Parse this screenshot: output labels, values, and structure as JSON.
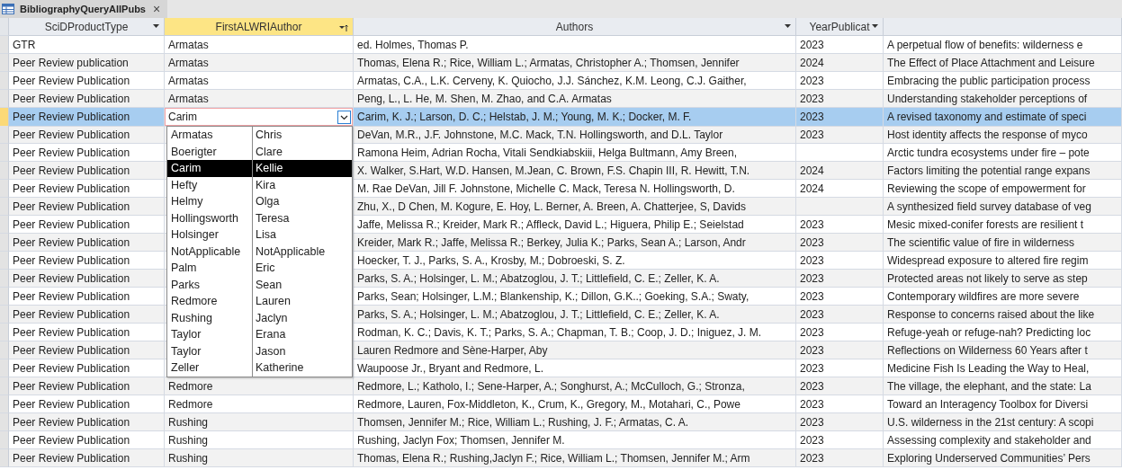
{
  "tab": {
    "title": "BibliographyQueryAllPubs",
    "close": "×"
  },
  "columns": [
    {
      "label": "SciDProductType",
      "kind": "filter",
      "active": false
    },
    {
      "label": "FirstALWRIAuthor",
      "kind": "sort",
      "active": true
    },
    {
      "label": "Authors",
      "kind": "filter",
      "active": false
    },
    {
      "label": "YearPublicat",
      "kind": "filter",
      "active": false
    },
    {
      "kind": "plain",
      "active": false
    }
  ],
  "rows": [
    {
      "type": "GTR",
      "first_author": "Armatas",
      "authors": "ed. Holmes, Thomas P.",
      "year": "2023",
      "title": "A perpetual flow of benefits: wilderness e",
      "selected": false,
      "editing": false
    },
    {
      "type": "Peer Review publication",
      "first_author": "Armatas",
      "authors": "Thomas, Elena R.; Rice, William L.; Armatas, Christopher A.; Thomsen, Jennifer",
      "year": "2024",
      "title": "The Effect of Place Attachment and Leisure",
      "selected": false,
      "editing": false
    },
    {
      "type": "Peer Review Publication",
      "first_author": "Armatas",
      "authors": "Armatas, C.A., L.K. Cerveny, K. Quiocho, J.J. Sánchez, K.M. Leong, C.J. Gaither,",
      "year": "2023",
      "title": "Embracing the public participation process",
      "selected": false,
      "editing": false
    },
    {
      "type": "Peer Review Publication",
      "first_author": "Armatas",
      "authors": "Peng, L., L. He, M. Shen, M. Zhao, and C.A. Armatas",
      "year": "2023",
      "title": "Understanding stakeholder perceptions of",
      "selected": false,
      "editing": false
    },
    {
      "type": "Peer Review Publication",
      "first_author": "Carim",
      "authors": "Carim, K. J.; Larson, D. C.; Helstab, J. M.; Young, M. K.; Docker, M. F.",
      "year": "2023",
      "title": "A revised taxonomy and estimate of speci",
      "selected": true,
      "editing": true
    },
    {
      "type": "Peer Review Publication",
      "authors": "DeVan, M.R., J.F. Johnstone, M.C. Mack, T.N. Hollingsworth, and D.L. Taylor",
      "year": "2023",
      "title": "Host identity affects the response of myco",
      "selected": false,
      "editing": false
    },
    {
      "type": "Peer Review Publication",
      "authors": "Ramona Heim, Adrian Rocha, Vitali Sendkiabskiii, Helga Bultmann, Amy Breen,",
      "title": "Arctic tundra ecosystems under fire – pote",
      "selected": false,
      "editing": false
    },
    {
      "type": "Peer Review Publication",
      "authors": "X. Walker, S.Hart, W.D. Hansen, M.Jean, C. Brown, F.S. Chapin III, R. Hewitt, T.N.",
      "year": "2024",
      "title": "Factors limiting the potential range expans",
      "selected": false,
      "editing": false
    },
    {
      "type": "Peer Review Publication",
      "authors": "M. Rae DeVan, Jill F. Johnstone, Michelle C. Mack, Teresa N. Hollingsworth, D.",
      "year": "2024",
      "title": "Reviewing the scope of empowerment for",
      "selected": false,
      "editing": false
    },
    {
      "type": "Peer Review Publication",
      "authors": "Zhu, X., D Chen, M. Kogure, E. Hoy, L. Berner, A. Breen, A. Chatterjee, S, Davids",
      "title": "A synthesized field survey database of veg",
      "selected": false,
      "editing": false
    },
    {
      "type": "Peer Review Publication",
      "authors": "Jaffe, Melissa R.; Kreider, Mark R.; Affleck, David L.; Higuera, Philip E.; Seielstad",
      "year": "2023",
      "title": "Mesic mixed-conifer forests are resilient t",
      "selected": false,
      "editing": false
    },
    {
      "type": "Peer Review Publication",
      "authors": "Kreider, Mark R.; Jaffe, Melissa R.; Berkey, Julia K.; Parks, Sean A.; Larson, Andr",
      "year": "2023",
      "title": "The scientific value of fire in wilderness",
      "selected": false,
      "editing": false
    },
    {
      "type": "Peer Review Publication",
      "authors": "Hoecker, T. J., Parks, S. A., Krosby, M.; Dobroeski, S. Z.",
      "year": "2023",
      "title": "Widespread exposure to altered fire regim",
      "selected": false,
      "editing": false
    },
    {
      "type": "Peer Review Publication",
      "authors": "Parks, S. A.; Holsinger, L. M.; Abatzoglou, J. T.; Littlefield, C. E.; Zeller, K. A.",
      "year": "2023",
      "title": "Protected areas not likely to serve as step",
      "selected": false,
      "editing": false
    },
    {
      "type": "Peer Review Publication",
      "authors": "Parks, Sean; Holsinger, L.M.; Blankenship, K.; Dillon, G.K..; Goeking, S.A.; Swaty,",
      "year": "2023",
      "title": "Contemporary wildfires are more severe",
      "selected": false,
      "editing": false
    },
    {
      "type": "Peer Review Publication",
      "authors": "Parks, S. A.; Holsinger, L. M.; Abatzoglou, J. T.; Littlefield, C. E.; Zeller, K. A.",
      "year": "2023",
      "title": "Response to concerns raised about the like",
      "selected": false,
      "editing": false
    },
    {
      "type": "Peer Review Publication",
      "authors": "Rodman, K. C.; Davis, K. T.; Parks, S. A.; Chapman, T. B.; Coop, J. D.; Iniguez, J. M.",
      "year": "2023",
      "title": "Refuge-yeah or refuge-nah? Predicting loc",
      "selected": false,
      "editing": false
    },
    {
      "type": "Peer Review Publication",
      "authors": "Lauren Redmore and Sène-Harper, Aby",
      "year": "2023",
      "title": "Reflections on Wilderness 60 Years after t",
      "selected": false,
      "editing": false
    },
    {
      "type": "Peer Review Publication",
      "authors": "Waupoose Jr., Bryant and Redmore, L.",
      "year": "2023",
      "title": "Medicine Fish Is Leading the Way to Heal,",
      "selected": false,
      "editing": false
    },
    {
      "type": "Peer Review Publication",
      "first_author": "Redmore",
      "authors": "Redmore, L.; Katholo, I.; Sene-Harper, A.; Songhurst, A.; McCulloch, G.; Stronza,",
      "year": "2023",
      "title": "The village, the elephant, and the state: La",
      "selected": false,
      "editing": false
    },
    {
      "type": "Peer Review Publication",
      "first_author": "Redmore",
      "authors": "Redmore, Lauren, Fox-Middleton, K., Crum, K., Gregory, M., Motahari, C., Powe",
      "year": "2023",
      "title": "Toward an Interagency Toolbox for Diversi",
      "selected": false,
      "editing": false
    },
    {
      "type": "Peer Review Publication",
      "first_author": "Rushing",
      "authors": "Thomsen, Jennifer M.; Rice, William L.; Rushing, J. F.; Armatas, C. A.",
      "year": "2023",
      "title": "U.S. wilderness in the 21st century: A scopi",
      "selected": false,
      "editing": false
    },
    {
      "type": "Peer Review Publication",
      "first_author": "Rushing",
      "authors": "Rushing, Jaclyn Fox; Thomsen, Jennifer M.",
      "year": "2023",
      "title": "Assessing complexity and stakeholder and",
      "selected": false,
      "editing": false
    },
    {
      "type": "Peer Review Publication",
      "first_author": "Rushing",
      "authors": "Thomas, Elena R.; Rushing,Jaclyn F.; Rice, William L.; Thomsen, Jennifer M.; Arm",
      "year": "2023",
      "title": "Exploring Underserved Communities’ Pers",
      "selected": false,
      "editing": false
    }
  ],
  "dropdown": {
    "items": [
      {
        "last": "Armatas",
        "first": "Chris",
        "selected": false
      },
      {
        "last": "Boerigter",
        "first": "Clare",
        "selected": false
      },
      {
        "last": "Carim",
        "first": "Kellie",
        "selected": true
      },
      {
        "last": "Hefty",
        "first": "Kira",
        "selected": false
      },
      {
        "last": "Helmy",
        "first": "Olga",
        "selected": false
      },
      {
        "last": "Hollingsworth",
        "first": "Teresa",
        "selected": false
      },
      {
        "last": "Holsinger",
        "first": "Lisa",
        "selected": false
      },
      {
        "last": "NotApplicable",
        "first": "NotApplicable",
        "selected": false
      },
      {
        "last": "Palm",
        "first": "Eric",
        "selected": false
      },
      {
        "last": "Parks",
        "first": "Sean",
        "selected": false
      },
      {
        "last": "Redmore",
        "first": "Lauren",
        "selected": false
      },
      {
        "last": "Rushing",
        "first": "Jaclyn",
        "selected": false
      },
      {
        "last": "Taylor",
        "first": "Erana",
        "selected": false
      },
      {
        "last": "Taylor",
        "first": "Jason",
        "selected": false
      },
      {
        "last": "Zeller",
        "first": "Katherine",
        "selected": false
      }
    ]
  }
}
